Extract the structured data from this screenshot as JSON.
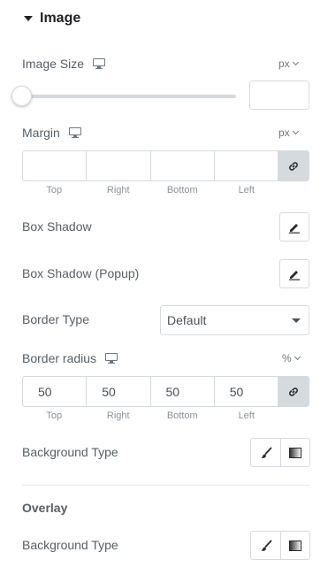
{
  "section": {
    "title": "Image"
  },
  "image_size": {
    "label": "Image Size",
    "unit": "px",
    "value": ""
  },
  "margin": {
    "label": "Margin",
    "unit": "px",
    "values": [
      "",
      "",
      "",
      ""
    ],
    "sides": [
      "Top",
      "Right",
      "Bottom",
      "Left"
    ]
  },
  "box_shadow": {
    "label": "Box Shadow"
  },
  "box_shadow_popup": {
    "label": "Box Shadow (Popup)"
  },
  "border_type": {
    "label": "Border Type",
    "selected": "Default"
  },
  "border_radius": {
    "label": "Border radius",
    "unit": "%",
    "values": [
      "50",
      "50",
      "50",
      "50"
    ],
    "sides": [
      "Top",
      "Right",
      "Bottom",
      "Left"
    ]
  },
  "background_type": {
    "label": "Background Type"
  },
  "overlay": {
    "title": "Overlay",
    "background_type_label": "Background Type"
  }
}
